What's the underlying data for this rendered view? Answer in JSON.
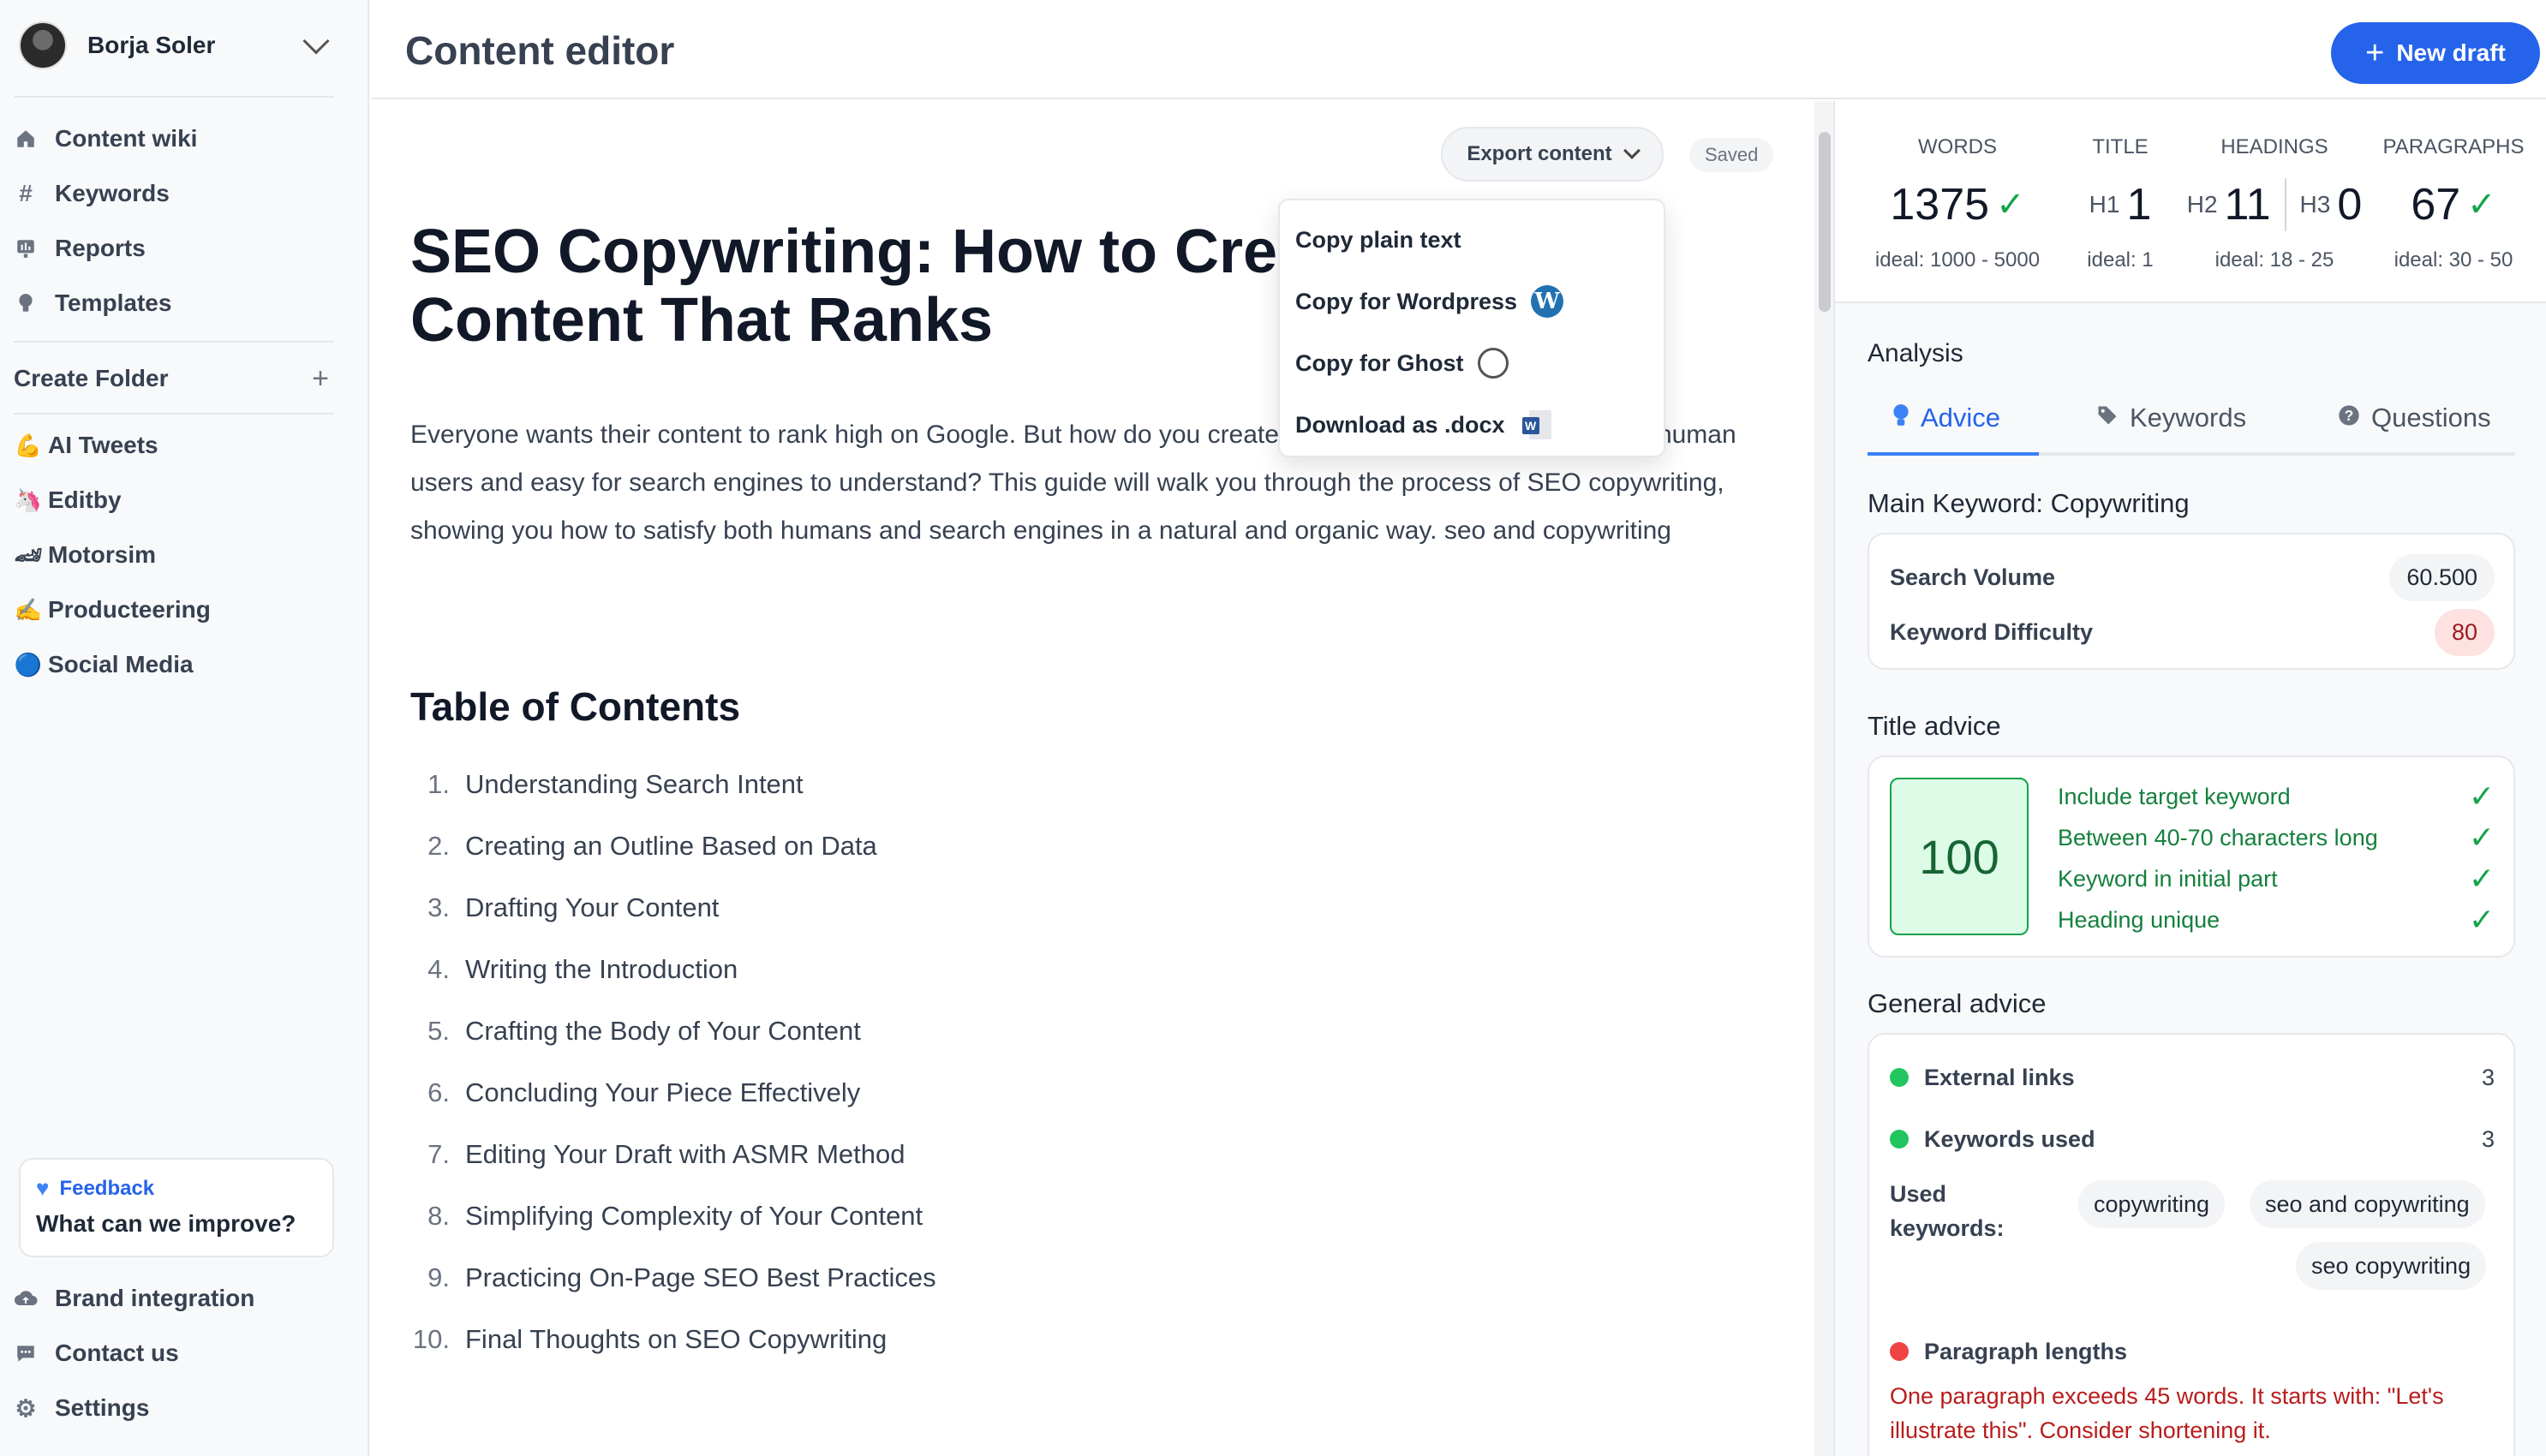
{
  "sidebar": {
    "user_name": "Borja Soler",
    "nav": [
      {
        "label": "Content wiki",
        "icon": "home-icon"
      },
      {
        "label": "Keywords",
        "icon": "hash-icon"
      },
      {
        "label": "Reports",
        "icon": "chart-icon"
      },
      {
        "label": "Templates",
        "icon": "bulb-icon"
      }
    ],
    "create_folder": "Create Folder",
    "folders": [
      {
        "emoji": "💪",
        "label": "AI Tweets"
      },
      {
        "emoji": "🦄",
        "label": "Editby"
      },
      {
        "emoji": "🏎",
        "label": "Motorsim"
      },
      {
        "emoji": "✍️",
        "label": "Producteering"
      },
      {
        "emoji": "🔵",
        "label": "Social Media"
      }
    ],
    "feedback": {
      "title": "Feedback",
      "text": "What can we improve?"
    },
    "bottom": [
      {
        "label": "Brand integration",
        "icon": "cloud-upload-icon"
      },
      {
        "label": "Contact us",
        "icon": "chat-icon"
      },
      {
        "label": "Settings",
        "icon": "gear-icon"
      }
    ]
  },
  "header": {
    "title": "Content editor",
    "new_draft": "New draft"
  },
  "editor": {
    "export_label": "Export content",
    "saved_label": "Saved",
    "doc_title": "SEO Copywriting: How to Create Content That Ranks",
    "intro": "Everyone wants their content to rank high on Google. But how do you create content that is both appealing to human users and easy for search engines to understand? This guide will walk you through the process of SEO copywriting, showing you how to satisfy both humans and search engines in a natural and organic way. seo and copywriting",
    "toc_title": "Table of Contents",
    "toc": [
      {
        "n": "1.",
        "t": "Understanding Search Intent"
      },
      {
        "n": "2.",
        "t": "Creating an Outline Based on Data"
      },
      {
        "n": "3.",
        "t": "Drafting Your Content"
      },
      {
        "n": "4.",
        "t": "Writing the Introduction"
      },
      {
        "n": "5.",
        "t": "Crafting the Body of Your Content"
      },
      {
        "n": "6.",
        "t": "Concluding Your Piece Effectively"
      },
      {
        "n": "7.",
        "t": "Editing Your Draft with ASMR Method"
      },
      {
        "n": "8.",
        "t": "Simplifying Complexity of Your Content"
      },
      {
        "n": "9.",
        "t": "Practicing On-Page SEO Best Practices"
      },
      {
        "n": "10.",
        "t": "Final Thoughts on SEO Copywriting"
      }
    ]
  },
  "export_menu": {
    "items": [
      {
        "label": "Copy plain text",
        "icon": ""
      },
      {
        "label": "Copy for Wordpress",
        "icon": "wordpress-icon"
      },
      {
        "label": "Copy for Ghost",
        "icon": "ghost-icon"
      },
      {
        "label": "Download as .docx",
        "icon": "word-doc-icon"
      }
    ]
  },
  "stats": {
    "words": {
      "label": "WORDS",
      "value": "1375",
      "ideal": "ideal: 1000 - 5000"
    },
    "title": {
      "label": "TITLE",
      "prefix": "H1",
      "value": "1",
      "ideal": "ideal: 1"
    },
    "headings": {
      "label": "HEADINGS",
      "h2_prefix": "H2",
      "h2": "11",
      "h3_prefix": "H3",
      "h3": "0",
      "ideal": "ideal: 18 - 25"
    },
    "paragraphs": {
      "label": "PARAGRAPHS",
      "value": "67",
      "ideal": "ideal: 30 - 50"
    }
  },
  "analysis": {
    "title": "Analysis",
    "tabs": [
      "Advice",
      "Keywords",
      "Questions"
    ],
    "main_keyword": "Main Keyword: Copywriting",
    "search_volume_label": "Search Volume",
    "search_volume": "60.500",
    "difficulty_label": "Keyword Difficulty",
    "difficulty": "80",
    "title_advice": "Title advice",
    "title_score": "100",
    "title_checks": [
      "Include target keyword",
      "Between 40-70 characters long",
      "Keyword in initial part",
      "Heading unique"
    ],
    "general_advice": "General advice",
    "external_links_label": "External links",
    "external_links": "3",
    "keywords_used_label": "Keywords used",
    "keywords_used": "3",
    "used_keywords_label": "Used keywords:",
    "used_keywords": [
      "copywriting",
      "seo and copywriting",
      "seo copywriting"
    ],
    "paragraph_lengths_label": "Paragraph lengths",
    "paragraph_warning": "One paragraph exceeds 45 words. It starts with: \"Let's illustrate this\". Consider shortening it."
  },
  "colors": {
    "accent": "#2563eb",
    "success": "#16a34a",
    "danger": "#dc2626"
  }
}
